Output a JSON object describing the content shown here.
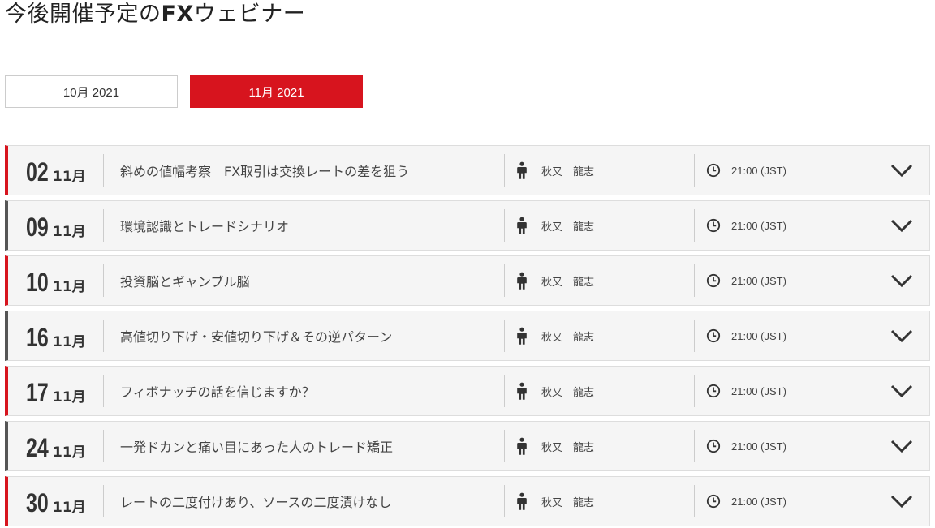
{
  "page": {
    "title_prefix": "今後開催予定の",
    "title_fx": "FX",
    "title_suffix": "ウェビナー"
  },
  "month_tabs": [
    {
      "label": "10月 2021",
      "active": false
    },
    {
      "label": "11月 2021",
      "active": true
    }
  ],
  "colors": {
    "accent": "#d7141e",
    "row_bg": "#f5f5f5",
    "neutral_bar": "#555555"
  },
  "webinars": [
    {
      "day": "02",
      "month": "11月",
      "title": "斜めの値幅考察　FX取引は交換レートの差を狙う",
      "speaker": "秋又　龍志",
      "time": "21:00 (JST)"
    },
    {
      "day": "09",
      "month": "11月",
      "title": "環境認識とトレードシナリオ",
      "speaker": "秋又　龍志",
      "time": "21:00 (JST)"
    },
    {
      "day": "10",
      "month": "11月",
      "title": "投資脳とギャンブル脳",
      "speaker": "秋又　龍志",
      "time": "21:00 (JST)"
    },
    {
      "day": "16",
      "month": "11月",
      "title": "高値切り下げ・安値切り下げ＆その逆パターン",
      "speaker": "秋又　龍志",
      "time": "21:00 (JST)"
    },
    {
      "day": "17",
      "month": "11月",
      "title": "フィボナッチの話を信じますか？",
      "speaker": "秋又　龍志",
      "time": "21:00 (JST)"
    },
    {
      "day": "24",
      "month": "11月",
      "title": "一発ドカンと痛い目にあった人のトレード矯正",
      "speaker": "秋又　龍志",
      "time": "21:00 (JST)"
    },
    {
      "day": "30",
      "month": "11月",
      "title": "レートの二度付けあり、ソースの二度漬けなし",
      "speaker": "秋又　龍志",
      "time": "21:00 (JST)"
    }
  ]
}
